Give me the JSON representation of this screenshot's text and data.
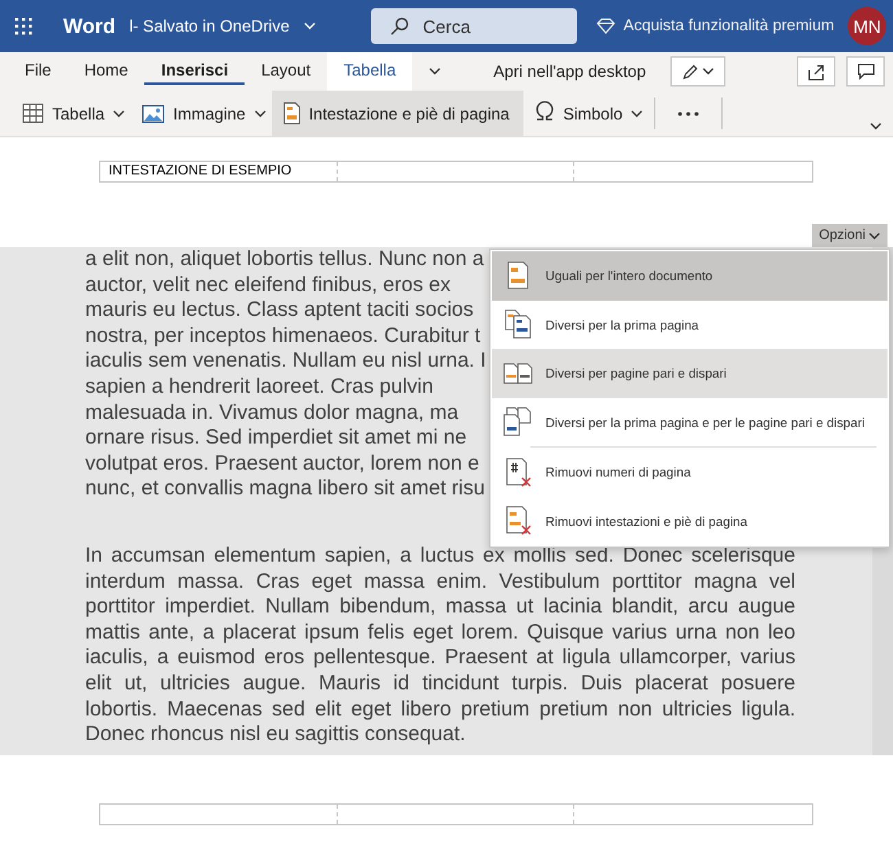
{
  "title_bar": {
    "app": "Word",
    "document": "l- Salvato in OneDrive",
    "search": {
      "placeholder": "Cerca"
    },
    "premium": "Acquista funzionalità premium",
    "avatar": "MN"
  },
  "ribbon_tabs": [
    {
      "label": "File",
      "selected": false,
      "kind": "plain"
    },
    {
      "label": "Home",
      "selected": false,
      "kind": "plain"
    },
    {
      "label": "Inserisci",
      "selected": true,
      "kind": "plain"
    },
    {
      "label": "Layout",
      "selected": false,
      "kind": "plain"
    },
    {
      "label": "Tabella",
      "selected": false,
      "kind": "contextual"
    }
  ],
  "open_desktop": "Apri nell'app desktop",
  "toolbar": [
    {
      "label": "Tabella",
      "kind": "table",
      "dropdown": true,
      "pressed": false
    },
    {
      "label": "Immagine",
      "kind": "image",
      "dropdown": true,
      "pressed": false
    },
    {
      "label": "Intestazione e piè di pagina",
      "kind": "header",
      "dropdown": false,
      "pressed": true
    },
    {
      "label": "Simbolo",
      "kind": "symbol",
      "dropdown": true,
      "pressed": false
    }
  ],
  "header_table": {
    "cells": [
      "INTESTAZIONE DI ESEMPIO"
    ]
  },
  "options_button": "Opzioni",
  "body": {
    "paragraphs": [
      {
        "lines": [
          "a elit non, aliquet lobortis tellus. Nunc non a",
          "auctor, velit nec eleifend finibus, eros ex",
          "mauris eu lectus. Class aptent taciti socios",
          "nostra, per inceptos himenaeos. Curabitur t",
          "iaculis sem venenatis. Nullam eu nisl urna. I",
          "sapien a hendrerit laoreet. Cras pulvin",
          "malesuada in. Vivamus dolor magna, ma",
          "ornare risus. Sed imperdiet sit amet mi ne",
          "volutpat eros. Praesent auctor, lorem non e",
          "nunc, et convallis magna libero sit amet risu"
        ]
      },
      {
        "lines": [
          "In accumsan elementum sapien, a luctus ex mollis sed. Donec scelerisque",
          "interdum massa. Cras eget massa enim. Vestibulum porttitor magna vel",
          "porttitor imperdiet. Nullam bibendum, massa ut lacinia blandit, arcu augue",
          "mattis ante, a placerat ipsum felis eget lorem. Quisque varius urna non leo",
          "iaculis, a euismod eros pellentesque. Praesent at ligula ullamcorper, varius",
          "elit ut, ultricies augue. Mauris id tincidunt turpis. Duis placerat posuere",
          "lobortis. Maecenas sed elit eget libero pretium pretium non ultricies ligula.",
          "Donec rhoncus nisl eu sagittis consequat."
        ]
      }
    ]
  },
  "options_menu": [
    {
      "label": "Uguali per l'intero documento",
      "kind": "same",
      "selected": true,
      "hovered": false
    },
    {
      "label": "Diversi per la prima pagina",
      "kind": "first",
      "selected": false,
      "hovered": false
    },
    {
      "label": "Diversi per pagine pari e dispari",
      "kind": "oddeven",
      "selected": false,
      "hovered": true
    },
    {
      "label": "Diversi per la prima pagina e per le pagine pari e dispari",
      "kind": "firstoddeven",
      "selected": false,
      "hovered": false,
      "divider_after": true
    },
    {
      "label": "Rimuovi numeri di pagina",
      "kind": "removenum",
      "selected": false,
      "hovered": false
    },
    {
      "label": "Rimuovi intestazioni e piè di pagina",
      "kind": "removehdr",
      "selected": false,
      "hovered": false
    }
  ]
}
